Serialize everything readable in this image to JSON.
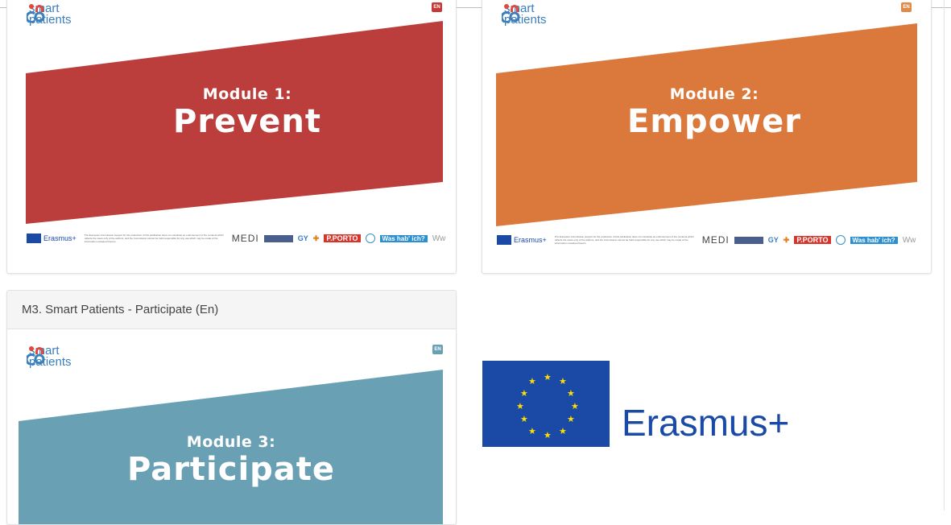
{
  "cards": [
    {
      "brand": [
        "smart",
        "patients"
      ],
      "lang_badge": "EN",
      "module_label": "Module 1:",
      "module_title": "Prevent",
      "color": "#bb3e3d",
      "footer": {
        "erasmus": "Erasmus+",
        "disclaimer": "The European Commission support for the production of this publication does not constitute an endorsement of the contents which reflects the views only of the authors, and the Commission cannot be held responsible for any use which may be made of the information contained therein.",
        "partners": [
          "MEDI",
          "GY",
          "P.PORTO",
          "Was hab' ich?",
          "Ww"
        ]
      }
    },
    {
      "brand": [
        "smart",
        "patients"
      ],
      "lang_badge": "EN",
      "module_label": "Module 2:",
      "module_title": "Empower",
      "color": "#db793c",
      "footer": {
        "erasmus": "Erasmus+",
        "disclaimer": "The European Commission support for the production of this publication does not constitute an endorsement of the contents which reflects the views only of the authors, and the Commission cannot be held responsible for any use which may be made of the information contained therein.",
        "partners": [
          "MEDI",
          "GY",
          "P.PORTO",
          "Was hab' ich?",
          "Ww"
        ]
      }
    },
    {
      "header": "M3. Smart Patients - Participate (En)",
      "brand": [
        "smart",
        "patients"
      ],
      "lang_badge": "EN",
      "module_label": "Module 3:",
      "module_title": "Participate",
      "color": "#6aa0b4"
    }
  ],
  "erasmus_logo": {
    "text": "Erasmus+"
  },
  "colors": {
    "erasmus_blue": "#1a4aa6",
    "eu_star": "#ffdd00",
    "brand_blue": "#3b7fbd",
    "brand_red": "#e04a3c"
  }
}
